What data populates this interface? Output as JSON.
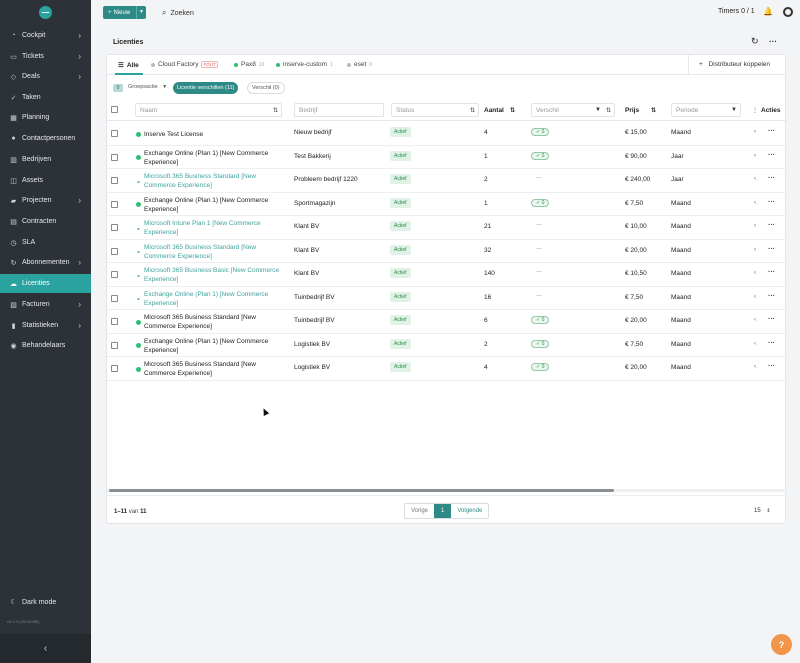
{
  "sidebar": {
    "items": [
      {
        "label": "Cockpit",
        "icon": "speedometer-icon",
        "chevron": true
      },
      {
        "label": "Tickets",
        "icon": "ticket-icon",
        "chevron": true
      },
      {
        "label": "Deals",
        "icon": "handshake-icon",
        "chevron": true
      },
      {
        "label": "Taken",
        "icon": "check-icon",
        "chevron": false
      },
      {
        "label": "Planning",
        "icon": "calendar-icon",
        "chevron": false
      },
      {
        "label": "Contactpersonen",
        "icon": "person-icon",
        "chevron": false
      },
      {
        "label": "Bedrijven",
        "icon": "building-icon",
        "chevron": false
      },
      {
        "label": "Assets",
        "icon": "box-icon",
        "chevron": false
      },
      {
        "label": "Projecten",
        "icon": "folder-icon",
        "chevron": true
      },
      {
        "label": "Contracten",
        "icon": "document-icon",
        "chevron": false
      },
      {
        "label": "SLA",
        "icon": "clock-icon",
        "chevron": false
      },
      {
        "label": "Abonnementen",
        "icon": "repeat-icon",
        "chevron": true
      },
      {
        "label": "Licenties",
        "icon": "cloud-icon",
        "chevron": false,
        "active": true
      },
      {
        "label": "Facturen",
        "icon": "invoice-icon",
        "chevron": true
      },
      {
        "label": "Statistieken",
        "icon": "chart-icon",
        "chevron": true
      },
      {
        "label": "Behandelaars",
        "icon": "users-icon",
        "chevron": false
      }
    ],
    "dark_mode": "Dark mode",
    "version": "v3.2.3 (30744985)"
  },
  "topbar": {
    "new_label": "Nieuw",
    "search_label": "Zoeken",
    "timers": "Timers 0 / 1"
  },
  "page": {
    "title": "Licenties"
  },
  "tabs": [
    {
      "label": "Alle",
      "active": true
    },
    {
      "label": "Cloud Factory",
      "badge": "FOUT",
      "dot": "#bbbbbb"
    },
    {
      "label": "Pax8",
      "count": "10",
      "dot": "#2fbf71"
    },
    {
      "label": "inserve-custom",
      "count": "1",
      "dot": "#2fbf71"
    },
    {
      "label": "eset",
      "count": "0",
      "dot": "#bbbbbb"
    }
  ],
  "distributor_link": "Distributeur koppelen",
  "filters": {
    "selected_count": "0",
    "group_action": "Groepsactie",
    "chip_active": "Licentie verschillen (11)",
    "chip": "Verschil (0)"
  },
  "columns": {
    "name": "Naam",
    "company": "Bedrijf",
    "status": "Status",
    "quantity": "Aantal",
    "difference": "Verschil",
    "price": "Prijs",
    "period": "Periode",
    "actions": "Acties"
  },
  "rows": [
    {
      "name": "Inserve Test License",
      "type": "ok",
      "company": "Nieuw bedrijf",
      "status": "Actief",
      "qty": "4",
      "diff": "0",
      "price": "€ 15,00",
      "period": "Maand"
    },
    {
      "name": "Exchange Online (Plan 1) [New Commerce Experience]",
      "type": "ok",
      "company": "Test Bakkerij",
      "status": "Actief",
      "qty": "1",
      "diff": "0",
      "price": "€ 90,00",
      "period": "Jaar"
    },
    {
      "name": "Microsoft 365 Business Standard [New Commerce Experience]",
      "type": "link",
      "company": "Probleem bedrijf 1220",
      "status": "Actief",
      "qty": "2",
      "diff": "—",
      "price": "€ 240,00",
      "period": "Jaar"
    },
    {
      "name": "Exchange Online (Plan 1) [New Commerce Experience]",
      "type": "ok",
      "company": "Sportmagazijn",
      "status": "Actief",
      "qty": "1",
      "diff": "0",
      "price": "€ 7,50",
      "period": "Maand"
    },
    {
      "name": "Microsoft Intune Plan 1 [New Commerce Experience]",
      "type": "link",
      "company": "Klant BV",
      "status": "Actief",
      "qty": "21",
      "diff": "—",
      "price": "€ 10,00",
      "period": "Maand"
    },
    {
      "name": "Microsoft 365 Business Standard [New Commerce Experience]",
      "type": "link",
      "company": "Klant BV",
      "status": "Actief",
      "qty": "32",
      "diff": "—",
      "price": "€ 20,00",
      "period": "Maand"
    },
    {
      "name": "Microsoft 365 Business Basic [New Commerce Experience]",
      "type": "link",
      "company": "Klant BV",
      "status": "Actief",
      "qty": "140",
      "diff": "—",
      "price": "€ 10,50",
      "period": "Maand"
    },
    {
      "name": "Exchange Online (Plan 1) [New Commerce Experience]",
      "type": "link",
      "company": "Tuinbedrijf BV",
      "status": "Actief",
      "qty": "16",
      "diff": "—",
      "price": "€ 7,50",
      "period": "Maand"
    },
    {
      "name": "Microsoft 365 Business Standard [New Commerce Experience]",
      "type": "ok",
      "company": "Tuinbedrijf BV",
      "status": "Actief",
      "qty": "6",
      "diff": "0",
      "price": "€ 20,00",
      "period": "Maand"
    },
    {
      "name": "Exchange Online (Plan 1) [New Commerce Experience]",
      "type": "ok",
      "company": "Logistiek BV",
      "status": "Actief",
      "qty": "2",
      "diff": "0",
      "price": "€ 7,50",
      "period": "Maand"
    },
    {
      "name": "Microsoft 365 Business Standard [New Commerce Experience]",
      "type": "ok",
      "company": "Logistiek BV",
      "status": "Actief",
      "qty": "4",
      "diff": "0",
      "price": "€ 20,00",
      "period": "Maand"
    }
  ],
  "footer": {
    "range": "1–11",
    "of": "van",
    "total": "11",
    "prev": "Vorige",
    "page": "1",
    "next": "Volgende",
    "per_page": "15"
  },
  "help_label": "?"
}
